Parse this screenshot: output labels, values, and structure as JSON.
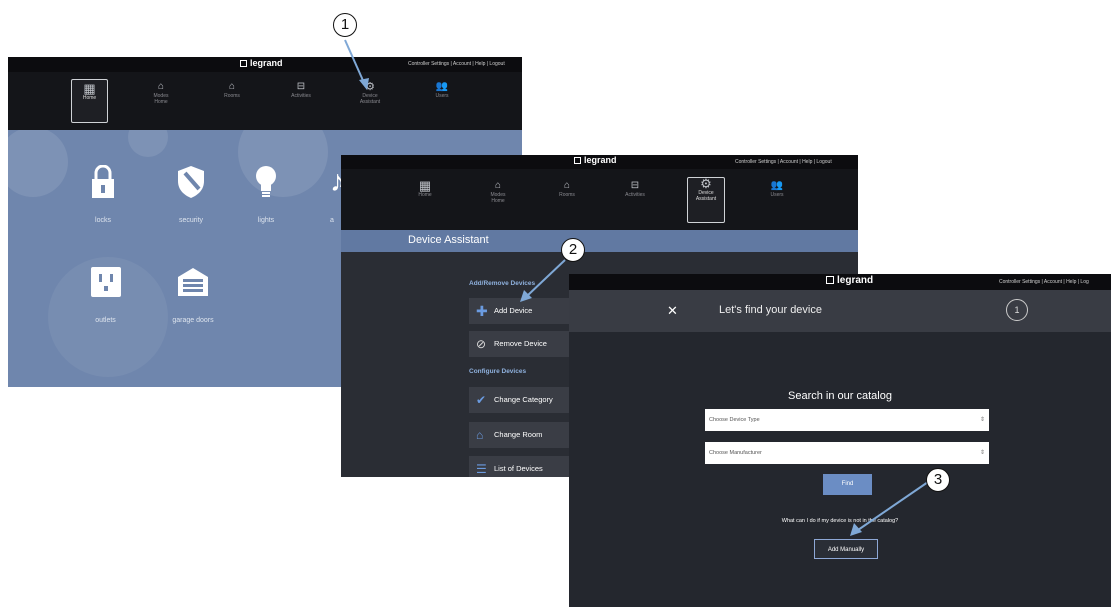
{
  "brand": {
    "logo_text": "legrand"
  },
  "screen1": {
    "top_links": "Controller Settings | Account | Help | Logout",
    "nav": [
      {
        "label": "Home",
        "sub": "",
        "icon": "grid-icon"
      },
      {
        "label": "Modes",
        "sub": "Home",
        "icon": "home-mode-icon"
      },
      {
        "label": "Rooms",
        "sub": "",
        "icon": "room-icon"
      },
      {
        "label": "Activities",
        "sub": "",
        "icon": "activities-icon"
      },
      {
        "label": "Device",
        "sub": "Assistant",
        "icon": "gear-icon"
      },
      {
        "label": "Users",
        "sub": "",
        "icon": "users-icon"
      }
    ],
    "tiles": [
      {
        "label": "locks",
        "icon": "lock-icon"
      },
      {
        "label": "security",
        "icon": "shield-icon"
      },
      {
        "label": "lights",
        "icon": "bulb-icon"
      },
      {
        "label": "a",
        "icon": "audio-icon"
      },
      {
        "label": "outlets",
        "icon": "outlet-icon"
      },
      {
        "label": "garage doors",
        "icon": "garage-icon"
      }
    ]
  },
  "screen2": {
    "top_links": "Controller Settings | Account | Help | Logout",
    "title": "Device Assistant",
    "sections": {
      "add_remove": "Add/Remove Devices",
      "configure": "Configure Devices"
    },
    "menu": [
      {
        "label": "Add Device",
        "icon": "plus-icon"
      },
      {
        "label": "Remove Device",
        "icon": "remove-circle-icon"
      },
      {
        "label": "Change Category",
        "icon": "check-icon"
      },
      {
        "label": "Change Room",
        "icon": "room-icon"
      },
      {
        "label": "List of Devices",
        "icon": "list-icon"
      }
    ]
  },
  "screen3": {
    "top_links": "Controller Settings | Account | Help | Log",
    "close_symbol": "✕",
    "title": "Let's find your device",
    "step": "1",
    "search_heading": "Search in our catalog",
    "device_type_placeholder": "Choose Device Type",
    "manufacturer_placeholder": "Choose Manufacturer",
    "find_label": "Find",
    "question": "What can I do if my device is not in the catalog?",
    "add_manually_label": "Add Manually"
  },
  "callouts": [
    "1",
    "2",
    "3"
  ],
  "colors": {
    "arrow": "#7fa8d6",
    "accent_blue": "#6b8dc4",
    "menu_bar": "#6179a2"
  }
}
